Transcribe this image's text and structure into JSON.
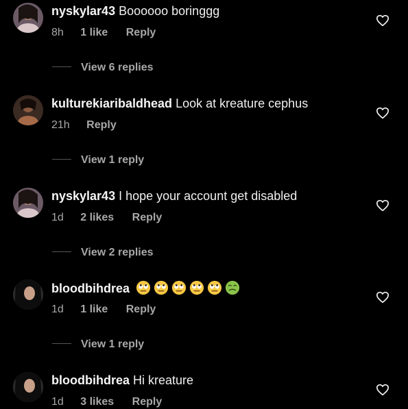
{
  "colors": {
    "background": "#000000",
    "primary_text": "#f5f5f5",
    "secondary_text": "#a8a8a8"
  },
  "comments": [
    {
      "username": "nyskylar43",
      "text": "Boooooo boringgg",
      "time": "8h",
      "likes": "1 like",
      "reply_label": "Reply",
      "view_replies": "View 6 replies",
      "avatar_icon": "avatar-photo",
      "heart_icon": "heart-outline-icon"
    },
    {
      "username": "kulturekiaribaldhead",
      "text": "Look at kreature cephus",
      "time": "21h",
      "likes": "",
      "reply_label": "Reply",
      "view_replies": "View 1 reply",
      "avatar_icon": "avatar-photo",
      "heart_icon": "heart-outline-icon"
    },
    {
      "username": "nyskylar43",
      "text": "I hope your account get disabled",
      "time": "1d",
      "likes": "2 likes",
      "reply_label": "Reply",
      "view_replies": "View 2 replies",
      "avatar_icon": "avatar-photo",
      "heart_icon": "heart-outline-icon"
    },
    {
      "username": "bloodbihdrea",
      "text": "",
      "emojis": [
        "eye-roll-emoji",
        "eye-roll-emoji",
        "eye-roll-emoji",
        "eye-roll-emoji",
        "eye-roll-emoji",
        "nauseated-face-emoji"
      ],
      "time": "1d",
      "likes": "1 like",
      "reply_label": "Reply",
      "view_replies": "View 1 reply",
      "avatar_icon": "avatar-photo",
      "heart_icon": "heart-outline-icon"
    },
    {
      "username": "bloodbihdrea",
      "text": "Hi kreature",
      "time": "1d",
      "likes": "3 likes",
      "reply_label": "Reply",
      "view_replies": "",
      "avatar_icon": "avatar-photo",
      "heart_icon": "heart-outline-icon"
    }
  ]
}
